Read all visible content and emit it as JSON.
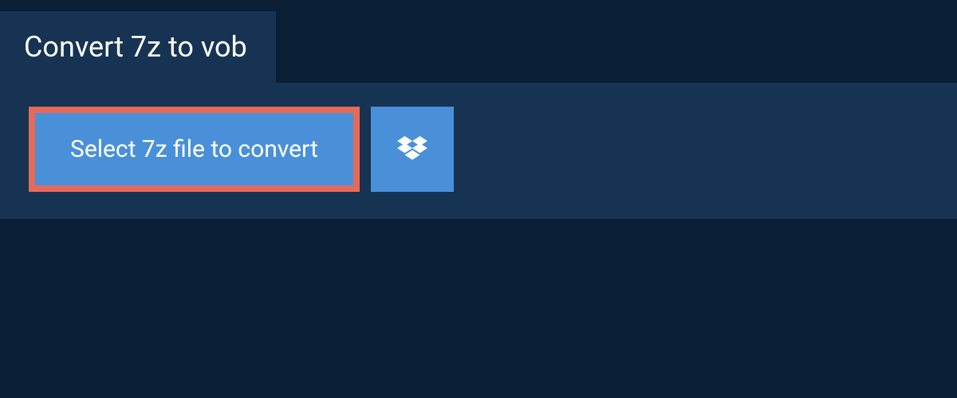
{
  "header": {
    "title": "Convert 7z to vob"
  },
  "converter": {
    "select_button_label": "Select 7z file to convert"
  },
  "colors": {
    "bg_dark": "#0a1e36",
    "panel": "#163353",
    "button_blue": "#4a90d9",
    "highlight_border": "#e56a5a"
  }
}
